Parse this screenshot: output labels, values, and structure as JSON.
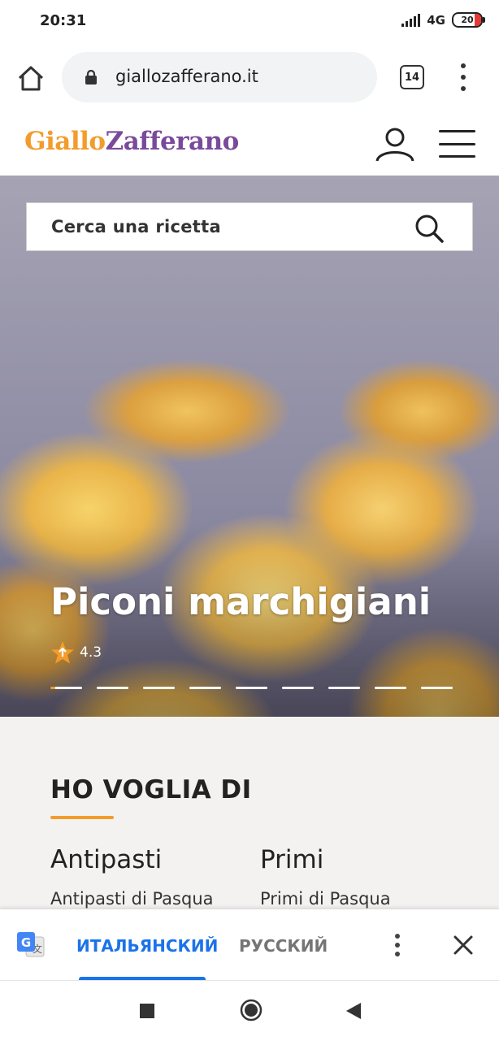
{
  "status_bar": {
    "time": "20:31",
    "network": "4G",
    "battery": "20"
  },
  "browser": {
    "url": "giallozafferano.it",
    "tab_count": "14"
  },
  "site": {
    "logo_part1": "Giallo",
    "logo_part2": "Zafferano"
  },
  "hero": {
    "search_placeholder": "Cerca una ricetta",
    "recipe_title": "Piconi marchigiani",
    "rating": "4.3",
    "slide_count": 9,
    "active_slide": 1
  },
  "categories": {
    "heading": "HO VOGLIA DI",
    "columns": [
      {
        "title": "Antipasti",
        "subtitle": "Antipasti di Pasqua"
      },
      {
        "title": "Primi",
        "subtitle": "Primi di Pasqua"
      }
    ]
  },
  "translate_bar": {
    "source_lang": "ИТАЛЬЯНСКИЙ",
    "target_lang": "РУССКИЙ"
  },
  "colors": {
    "brand_orange": "#f39c2b",
    "brand_purple": "#7a4a9a",
    "translate_blue": "#1a73e8"
  },
  "icons": [
    "home-icon",
    "lock-icon",
    "tabs-icon",
    "more-vert-icon",
    "user-icon",
    "hamburger-menu-icon",
    "search-icon",
    "star-icon",
    "google-translate-icon",
    "close-icon",
    "recent-apps-icon",
    "home-nav-icon",
    "back-nav-icon"
  ]
}
